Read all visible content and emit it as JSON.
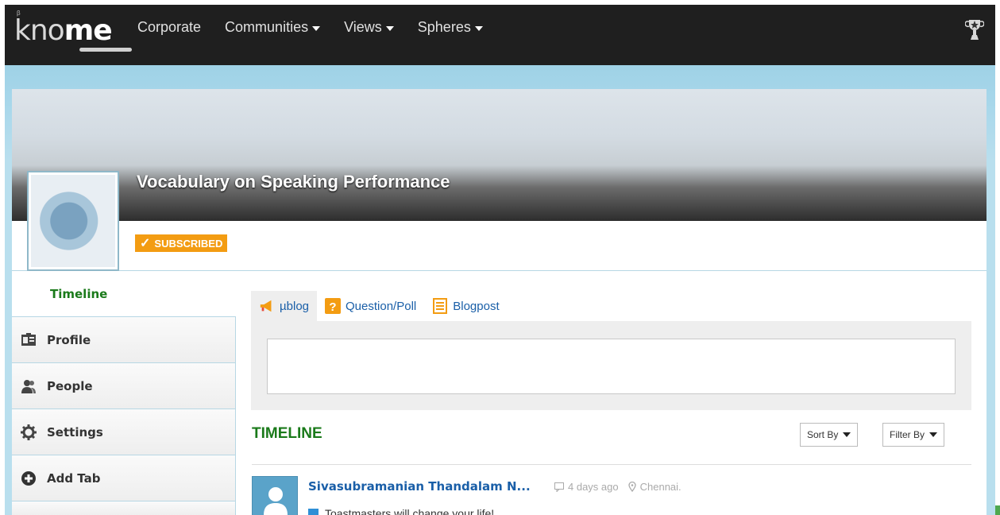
{
  "nav": {
    "brand_prefix": "kno",
    "brand_suffix": "me",
    "beta": "β",
    "items": [
      {
        "label": "Corporate",
        "has_caret": false
      },
      {
        "label": "Communities",
        "has_caret": true
      },
      {
        "label": "Views",
        "has_caret": true
      },
      {
        "label": "Spheres",
        "has_caret": true
      }
    ],
    "trophy_icon": "trophy-icon"
  },
  "community": {
    "title": "Vocabulary on Speaking Performance",
    "subscribed_label": "SUBSCRIBED",
    "subscribed_check": "✓"
  },
  "sidebar": {
    "active": "Timeline",
    "items": [
      {
        "label": "Profile",
        "icon": "profile-card-icon"
      },
      {
        "label": "People",
        "icon": "people-icon"
      },
      {
        "label": "Settings",
        "icon": "gear-icon"
      },
      {
        "label": "Add Tab",
        "icon": "plus-circle-icon"
      }
    ]
  },
  "post_tabs": [
    {
      "label": "µblog",
      "icon": "megaphone-icon",
      "active": true
    },
    {
      "label": "Question/Poll",
      "icon": "question-icon",
      "active": false
    },
    {
      "label": "Blogpost",
      "icon": "document-icon",
      "active": false
    }
  ],
  "composer": {
    "value": "",
    "placeholder": ""
  },
  "timeline": {
    "title": "TIMELINE",
    "sort_label": "Sort By",
    "filter_label": "Filter By"
  },
  "post": {
    "author": "Sivasubramanian Thandalam N...",
    "time": "4 days ago",
    "location": "Chennai.",
    "text": "Toastmasters will change your life!"
  },
  "colors": {
    "nav_bg": "#1f1f1f",
    "sky": "#a6d6ea",
    "accent_green": "#1a7a1a",
    "link_blue": "#1a5fa8",
    "badge_orange": "#f39c12"
  }
}
